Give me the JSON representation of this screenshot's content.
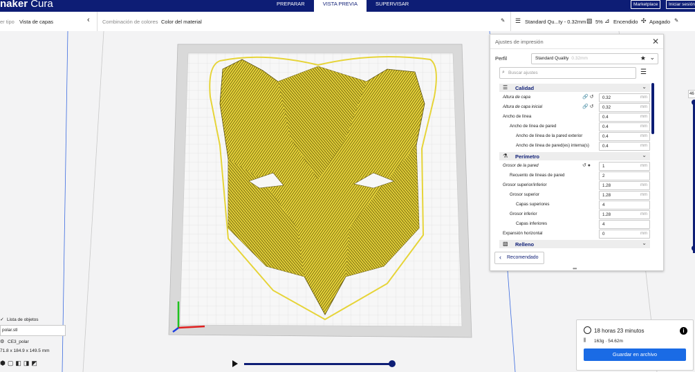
{
  "app": {
    "brand_prefix": "naker",
    "brand_suffix": " Cura"
  },
  "stages": [
    {
      "label": "PREPARAR",
      "active": false
    },
    {
      "label": "VISTA PREVIA",
      "active": true
    },
    {
      "label": "SUPERVISAR",
      "active": false
    }
  ],
  "top_buttons": {
    "marketplace": "Marketplace",
    "signin": "Iniciar sesión"
  },
  "view_bar": {
    "view_type_label": "er tipo",
    "view_type_value": "Vista de capas",
    "color_scheme_label": "Combinación de colores",
    "color_scheme_value": "Color del material"
  },
  "print_setup_bar": {
    "profile_summary": "Standard Qu...ty - 0.32mm",
    "infill": "5%",
    "support": "Encendido",
    "adhesion": "Apagado"
  },
  "settings_panel": {
    "title": "Ajustes de impresión",
    "profile_label": "Perfil",
    "profile_value": "Standard Quality",
    "profile_sub": "0.32mm",
    "search_placeholder": "Buscar ajustes",
    "categories": [
      {
        "label": "Calidad",
        "icon": "quality-icon"
      },
      {
        "label": "Perímetro",
        "icon": "shell-icon"
      },
      {
        "label": "Relleno",
        "icon": "infill-icon"
      }
    ],
    "settings": [
      {
        "label": "Altura de capa",
        "value": "0.32",
        "unit": "mm",
        "italic": true,
        "icons": "link-reset"
      },
      {
        "label": "Altura de capa inicial",
        "value": "0.32",
        "unit": "mm",
        "italic": true,
        "icons": "link-reset"
      },
      {
        "label": "Ancho de línea",
        "value": "0.4",
        "unit": "mm",
        "italic": false,
        "icons": ""
      },
      {
        "label": "Ancho de línea de pared",
        "value": "0.4",
        "unit": "mm",
        "italic": false,
        "icons": ""
      },
      {
        "label": "Ancho de línea de la pared exterior",
        "value": "0.4",
        "unit": "mm",
        "italic": false,
        "icons": ""
      },
      {
        "label": "Ancho de línea de pared(es) interna(s)",
        "value": "0.4",
        "unit": "mm",
        "italic": false,
        "icons": ""
      },
      {
        "label": "Grosor de la pared",
        "value": "1",
        "unit": "mm",
        "italic": true,
        "icons": "reset-info"
      },
      {
        "label": "Recuento de líneas de pared",
        "value": "2",
        "unit": "",
        "italic": false,
        "icons": ""
      },
      {
        "label": "Grosor superior/inferior",
        "value": "1.28",
        "unit": "mm",
        "italic": false,
        "icons": ""
      },
      {
        "label": "Grosor superior",
        "value": "1.28",
        "unit": "mm",
        "italic": false,
        "icons": ""
      },
      {
        "label": "Capas superiores",
        "value": "4",
        "unit": "",
        "italic": false,
        "icons": ""
      },
      {
        "label": "Grosor inferior",
        "value": "1.28",
        "unit": "mm",
        "italic": false,
        "icons": ""
      },
      {
        "label": "Capas inferiores",
        "value": "4",
        "unit": "",
        "italic": false,
        "icons": ""
      },
      {
        "label": "Expansión horizontal",
        "value": "0",
        "unit": "mm",
        "italic": false,
        "icons": ""
      }
    ],
    "recommended_button": "Recomendado"
  },
  "estimate": {
    "time": "18 horas 23 minutos",
    "material": "163g · 54.62m",
    "save_button": "Guardar en archivo"
  },
  "object_list": {
    "title": "Lista de objetos",
    "file": "polar.stl",
    "object_name": "CE3_polar",
    "dimensions": "71.8 x 184.9 x 149.5 mm"
  },
  "layer_slider": {
    "current_layer": "46"
  },
  "colors": {
    "accent": "#0d1d75",
    "model_yellow": "#e6d437",
    "save_blue": "#1a6be5"
  }
}
